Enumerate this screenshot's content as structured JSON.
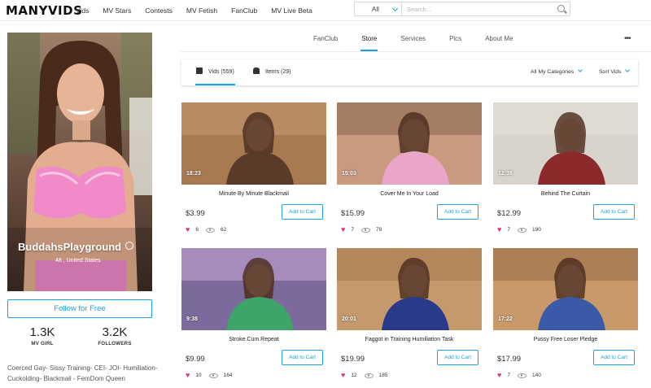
{
  "header": {
    "logo": "MANYVIDS",
    "nav": [
      "Vids",
      "MV Stars",
      "Contests",
      "MV Fetish",
      "FanClub",
      "MV Live Beta"
    ],
    "search_scope": "All",
    "search_placeholder": "Search..."
  },
  "profile": {
    "name": "BuddahsPlayground",
    "location": "48 , United States",
    "follow_label": "Follow for Free",
    "stats": [
      {
        "value": "1.3K",
        "label": "MV GIRL"
      },
      {
        "value": "3.2K",
        "label": "FOLLOWERS"
      }
    ],
    "bio": "Coerced Gay- Sissy Training- CEI- JOI- Humiliation- Cuckolding- Blackmail - FemDom Queen"
  },
  "tabs": [
    "FanClub",
    "Store",
    "Services",
    "Pics",
    "About Me"
  ],
  "active_tab": "Store",
  "subtabs": {
    "vids": "Vids (559)",
    "items": "Items (29)",
    "categories": "All My Categories",
    "sort": "Sort Vids"
  },
  "cart_label": "Add to Cart",
  "accent_color": "#1aa1e0",
  "videos": [
    {
      "title": "Minute By Minute Blackmail",
      "duration": "18:23",
      "price": "$3.99",
      "likes": "6",
      "views": "62"
    },
    {
      "title": "Cover Me In Your Load",
      "duration": "15:03",
      "price": "$15.99",
      "likes": "7",
      "views": "79"
    },
    {
      "title": "Behind The Curtain",
      "duration": "12:38",
      "price": "$12.99",
      "likes": "7",
      "views": "190"
    },
    {
      "title": "Stroke.Cum.Repeat",
      "duration": "9:38",
      "price": "$9.99",
      "likes": "10",
      "views": "164"
    },
    {
      "title": "Faggot in Training Humiliation Task",
      "duration": "20:01",
      "price": "$19.99",
      "likes": "12",
      "views": "185"
    },
    {
      "title": "Pussy Free Loser Pledge",
      "duration": "17:22",
      "price": "$17.99",
      "likes": "7",
      "views": "140"
    }
  ]
}
